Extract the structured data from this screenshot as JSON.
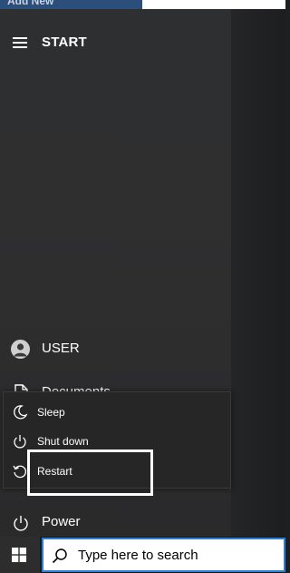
{
  "background_window": {
    "text": "Add New"
  },
  "start_menu": {
    "title": "START",
    "user_label": "USER",
    "documents_label": "Documents",
    "power_label": "Power"
  },
  "power_menu": {
    "items": [
      {
        "label": "Sleep",
        "icon": "moon-icon"
      },
      {
        "label": "Shut down",
        "icon": "power-icon"
      },
      {
        "label": "Restart",
        "icon": "restart-icon"
      }
    ]
  },
  "taskbar": {
    "search_placeholder": "Type here to search",
    "accent_color": "#2a7fd6"
  }
}
